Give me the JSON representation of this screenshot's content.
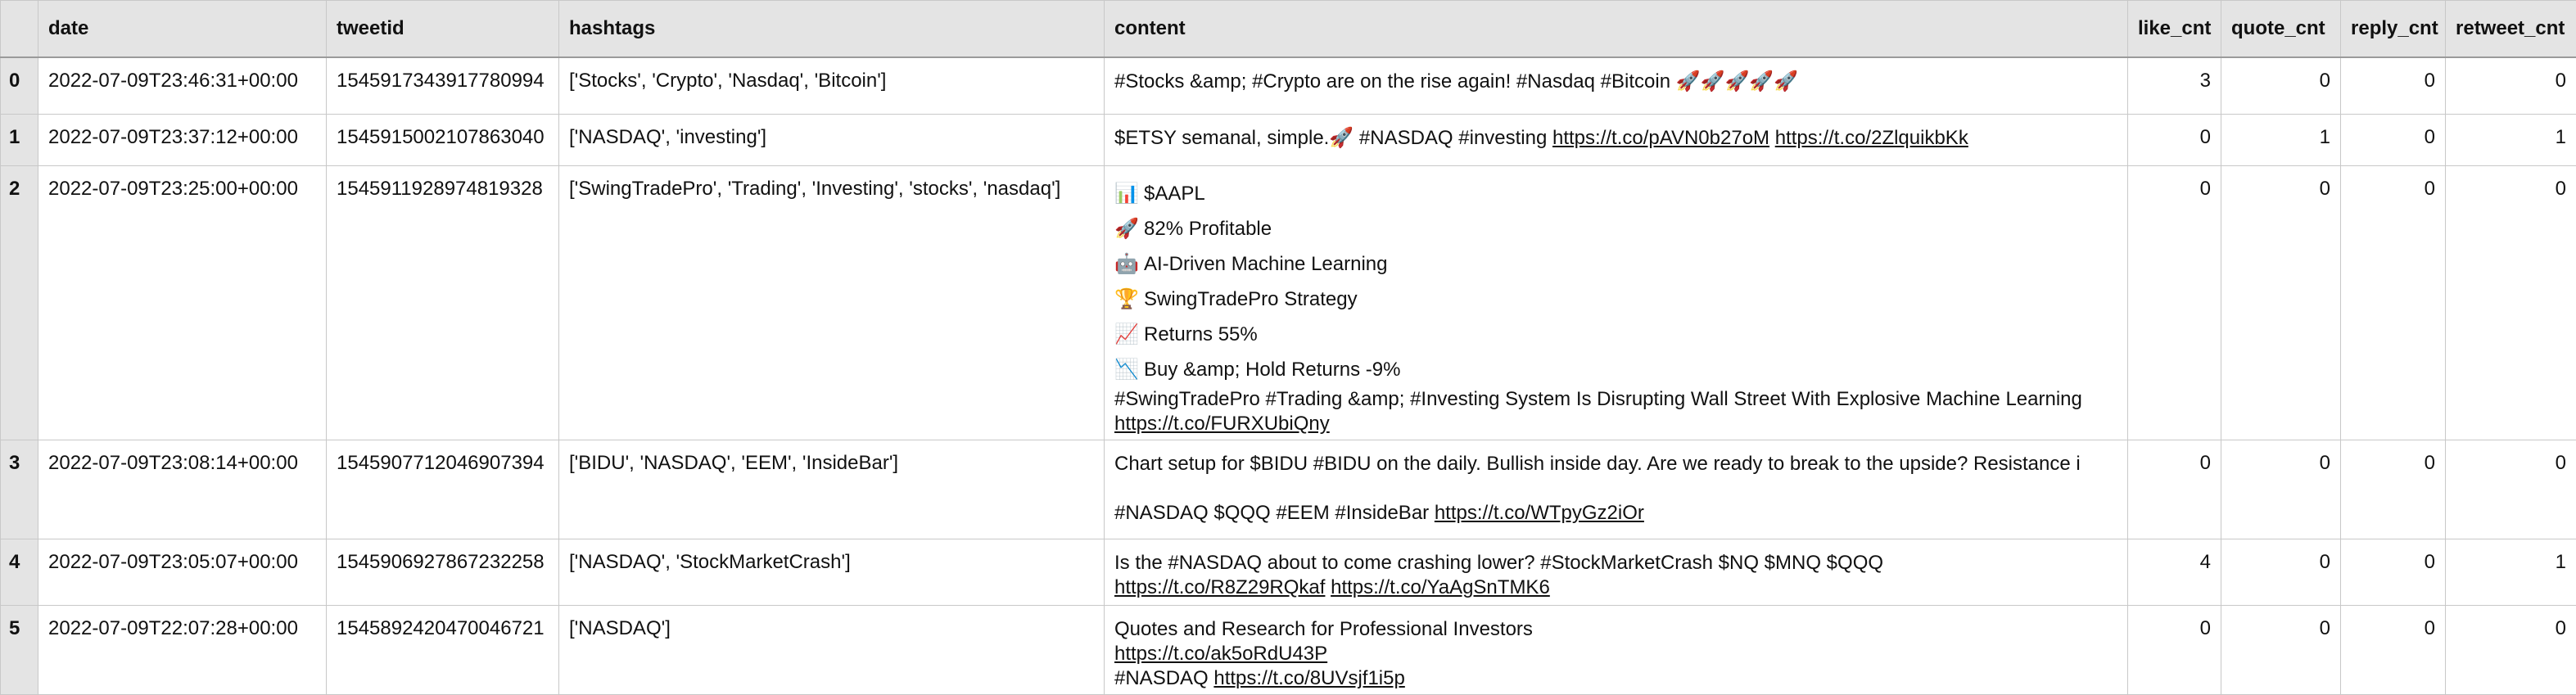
{
  "columns": [
    "",
    "date",
    "tweetid",
    "hashtags",
    "content",
    "like_cnt",
    "quote_cnt",
    "reply_cnt",
    "retweet_cnt"
  ],
  "rows": [
    {
      "index": "0",
      "date": "2022-07-09T23:46:31+00:00",
      "tweetid": "1545917343917780994",
      "hashtags": "['Stocks', 'Crypto', 'Nasdaq', 'Bitcoin']",
      "content_lines": [
        {
          "text": "#Stocks &amp; #Crypto are on the rise  again! #Nasdaq #Bitcoin  🚀🚀🚀🚀🚀",
          "link1": "",
          "link2": ""
        }
      ],
      "like_cnt": "3",
      "quote_cnt": "0",
      "reply_cnt": "0",
      "retweet_cnt": "0"
    },
    {
      "index": "1",
      "date": "2022-07-09T23:37:12+00:00",
      "tweetid": "1545915002107863040",
      "hashtags": "['NASDAQ', 'investing']",
      "content_lines": [
        {
          "text": "$ETSY semanal, simple.🚀 #NASDAQ #investing ",
          "link1": "https://t.co/pAVN0b27oM",
          "link2": "https://t.co/2ZlquikbKk"
        }
      ],
      "like_cnt": "0",
      "quote_cnt": "1",
      "reply_cnt": "0",
      "retweet_cnt": "1"
    },
    {
      "index": "2",
      "date": "2022-07-09T23:25:00+00:00",
      "tweetid": "1545911928974819328",
      "hashtags": "['SwingTradePro', 'Trading', 'Investing', 'stocks', 'nasdaq']",
      "content_lines": [
        {
          "emoji": "📊",
          "text": "$AAPL"
        },
        {
          "emoji": "🚀",
          "text": "82% Profitable"
        },
        {
          "emoji": "🤖",
          "text": "AI-Driven Machine Learning"
        },
        {
          "emoji": "🏆",
          "text": "SwingTradePro Strategy"
        },
        {
          "emoji": "📈",
          "text": "Returns 55%"
        },
        {
          "emoji": "📉",
          "text": "Buy &amp; Hold Returns -9%"
        },
        {
          "text": "#SwingTradePro #Trading &amp; #Investing System Is Disrupting Wall Street With Explosive Machine Learning"
        },
        {
          "text": "",
          "link1": "https://t.co/FURXUbiQny"
        }
      ],
      "like_cnt": "0",
      "quote_cnt": "0",
      "reply_cnt": "0",
      "retweet_cnt": "0"
    },
    {
      "index": "3",
      "date": "2022-07-09T23:08:14+00:00",
      "tweetid": "1545907712046907394",
      "hashtags": "['BIDU', 'NASDAQ', 'EEM', 'InsideBar']",
      "content_lines": [
        {
          "text": "Chart setup for $BIDU #BIDU on the daily. Bullish inside day. Are we ready to break to the upside? Resistance i"
        },
        {
          "text": ""
        },
        {
          "text": "#NASDAQ $QQQ #EEM  #InsideBar ",
          "link1": "https://t.co/WTpyGz2iOr"
        }
      ],
      "like_cnt": "0",
      "quote_cnt": "0",
      "reply_cnt": "0",
      "retweet_cnt": "0"
    },
    {
      "index": "4",
      "date": "2022-07-09T23:05:07+00:00",
      "tweetid": "1545906927867232258",
      "hashtags": "['NASDAQ', 'StockMarketCrash']",
      "content_lines": [
        {
          "text": "Is the #NASDAQ about to come crashing lower? #StockMarketCrash  $NQ $MNQ $QQQ"
        },
        {
          "text": "",
          "link1": "https://t.co/R8Z29RQkaf",
          "link2": "https://t.co/YaAgSnTMK6"
        }
      ],
      "like_cnt": "4",
      "quote_cnt": "0",
      "reply_cnt": "0",
      "retweet_cnt": "1"
    },
    {
      "index": "5",
      "date": "2022-07-09T22:07:28+00:00",
      "tweetid": "1545892420470046721",
      "hashtags": "['NASDAQ']",
      "content_lines": [
        {
          "text": "Quotes and Research for Professional Investors"
        },
        {
          "text": "",
          "link1": "https://t.co/ak5oRdU43P"
        },
        {
          "text": "#NASDAQ ",
          "link1": "https://t.co/8UVsjf1i5p"
        }
      ],
      "like_cnt": "0",
      "quote_cnt": "0",
      "reply_cnt": "0",
      "retweet_cnt": "0"
    }
  ]
}
